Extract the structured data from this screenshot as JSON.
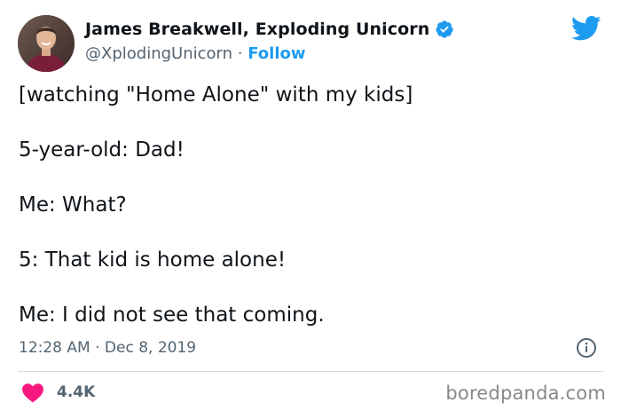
{
  "author": {
    "display_name": "James Breakwell, Exploding Unicorn",
    "handle": "@XplodingUnicorn",
    "separator": "·",
    "follow_label": "Follow",
    "verified": true
  },
  "tweet": {
    "lines": [
      "[watching \"Home Alone\" with my kids]",
      "5-year-old: Dad!",
      "Me: What?",
      "5: That kid is home alone!",
      "Me: I did not see that coming."
    ],
    "timestamp": "12:28 AM · Dec 8, 2019",
    "like_count": "4.4K"
  },
  "icons": {
    "brand": "twitter-bird-icon",
    "verified": "verified-badge-icon",
    "info": "info-icon",
    "like": "heart-icon"
  },
  "colors": {
    "accent": "#1d9bf0",
    "heart": "#f91880",
    "secondary_text": "#536471",
    "divider": "#cfd9de"
  },
  "watermark": "boredpanda.com"
}
